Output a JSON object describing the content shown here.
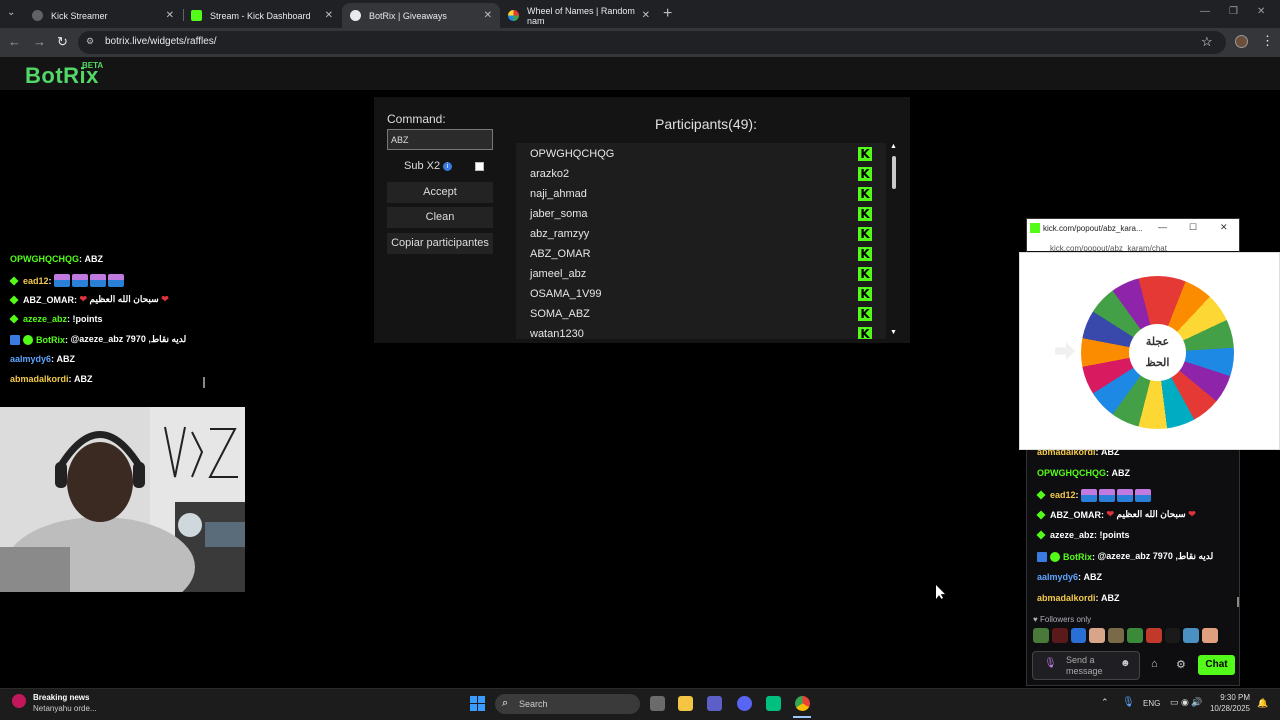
{
  "browser": {
    "tabs": [
      {
        "title": "Kick Streamer",
        "active": false
      },
      {
        "title": "Stream - Kick Dashboard",
        "active": false
      },
      {
        "title": "BotRix | Giveaways",
        "active": true
      },
      {
        "title": "Wheel of Names | Random nam",
        "active": false
      }
    ],
    "url": "botrix.live/widgets/raffles/",
    "icons": {
      "back": "back-arrow-icon",
      "forward": "forward-arrow-icon",
      "reload": "reload-icon",
      "star": "star-icon",
      "menu": "kebab-menu-icon"
    }
  },
  "site": {
    "logo": "BotRix",
    "beta": "BETA"
  },
  "raffle": {
    "command_label": "Command:",
    "command_value": "ABZ",
    "sub_label": "Sub X2",
    "sub_checked": false,
    "accept_label": "Accept",
    "clean_label": "Clean",
    "copy_label": "Copiar participantes",
    "participants_title": "Participants(49):",
    "participants": [
      "OPWGHQCHQG",
      "arazko2",
      "naji_ahmad",
      "jaber_soma",
      "abz_ramzyy",
      "ABZ_OMAR",
      "jameel_abz",
      "OSAMA_1V99",
      "SOMA_ABZ",
      "watan1230"
    ],
    "badge": "K"
  },
  "overlay_chat": [
    {
      "user": "OPWGHQCHQG",
      "color": "#53fc18",
      "msg": "ABZ",
      "badge": "none"
    },
    {
      "user": "ead12",
      "color": "#f2c94c",
      "msg": "",
      "badge": "gem",
      "emotes": 4
    },
    {
      "user": "ABZ_OMAR",
      "color": "#ffffff",
      "msg": "سبحان الله العظيم",
      "badge": "gem",
      "hearts": true
    },
    {
      "user": "azeze_abz",
      "color": "#53fc18",
      "msg": "!points",
      "badge": "gem"
    },
    {
      "user": "BotRix",
      "color": "#53fc18",
      "msg": "@azeze_abz 7970 ,لديه نقاط",
      "badge": "bot"
    },
    {
      "user": "aalmydy6",
      "color": "#5ea5ff",
      "msg": "ABZ",
      "badge": "none"
    },
    {
      "user": "abmadalkordi",
      "color": "#f2c94c",
      "msg": "ABZ",
      "badge": "none"
    }
  ],
  "popout": {
    "title": "kick.com/popout/abz_kara...",
    "url": "kick.com/popout/abz_karam/chat",
    "wheel_line1": "عجلة",
    "wheel_line2": "الحظ",
    "chat": [
      {
        "user": "abmadalkordi",
        "color": "#f2c94c",
        "msg": "ABZ",
        "badge": "none"
      },
      {
        "user": "OPWGHQCHQG",
        "color": "#53fc18",
        "msg": "ABZ",
        "badge": "none"
      },
      {
        "user": "ead12",
        "color": "#f2c94c",
        "msg": "",
        "badge": "gem",
        "emotes": 4
      },
      {
        "user": "ABZ_OMAR",
        "color": "#ffffff",
        "msg": "سبحان الله العظيم",
        "badge": "gem",
        "hearts": true
      },
      {
        "user": "azeze_abz",
        "color": "#ffffff",
        "msg": "!points",
        "badge": "gem"
      },
      {
        "user": "BotRix",
        "color": "#53fc18",
        "msg": "@azeze_abz 7970 ,لديه نقاط",
        "badge": "bot"
      },
      {
        "user": "aalmydy6",
        "color": "#5ea5ff",
        "msg": "ABZ",
        "badge": "none"
      },
      {
        "user": "abmadalkordi",
        "color": "#f2c94c",
        "msg": "ABZ",
        "badge": "none"
      }
    ],
    "followers_only": "Followers only",
    "send_placeholder": "Send a message",
    "chat_button": "Chat"
  },
  "taskbar": {
    "news_title": "Breaking news",
    "news_sub": "Netanyahu orde...",
    "search": "Search",
    "lang": "ENG",
    "time": "9:30 PM",
    "date": "10/28/2025"
  },
  "colors": {
    "kick_green": "#53fc18",
    "botrix_green": "#52d866"
  }
}
